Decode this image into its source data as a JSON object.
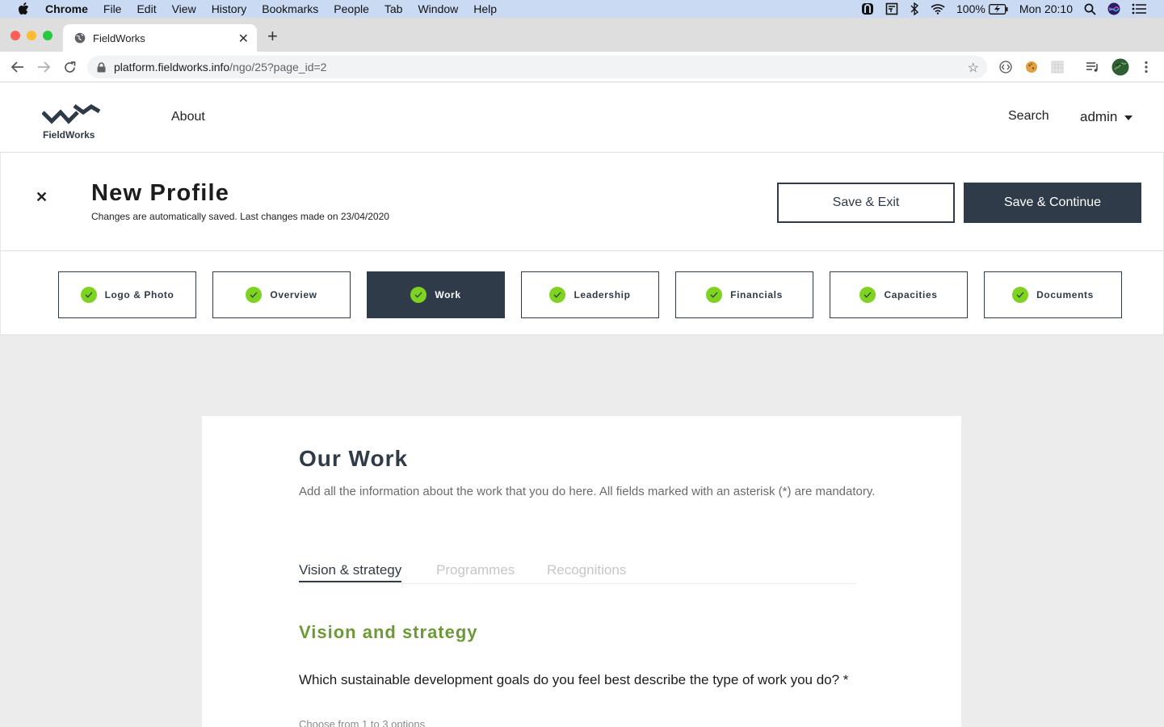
{
  "menubar": {
    "app": "Chrome",
    "items": [
      "File",
      "Edit",
      "View",
      "History",
      "Bookmarks",
      "People",
      "Tab",
      "Window",
      "Help"
    ],
    "battery": "100%",
    "clock": "Mon 20:10"
  },
  "browser": {
    "tab_title": "FieldWorks",
    "url_host": "platform.fieldworks.info",
    "url_path": "/ngo/25?page_id=2"
  },
  "site": {
    "logo_text": "FieldWorks",
    "nav_about": "About",
    "nav_search": "Search",
    "user": "admin"
  },
  "profile": {
    "title": "New Profile",
    "subtitle": "Changes are automatically saved. Last changes made on 23/04/2020",
    "save_exit": "Save & Exit",
    "save_continue": "Save & Continue"
  },
  "steps": [
    {
      "label": "Logo & Photo"
    },
    {
      "label": "Overview"
    },
    {
      "label": "Work"
    },
    {
      "label": "Leadership"
    },
    {
      "label": "Financials"
    },
    {
      "label": "Capacities"
    },
    {
      "label": "Documents"
    }
  ],
  "work": {
    "heading": "Our Work",
    "intro": "Add all the information about the work that you do here. All fields marked with an asterisk (*) are mandatory.",
    "tabs": [
      {
        "label": "Vision & strategy"
      },
      {
        "label": "Programmes"
      },
      {
        "label": "Recognitions"
      }
    ],
    "section_heading": "Vision and strategy",
    "question": "Which sustainable development goals do you feel best describe the type of work you do? *",
    "hint": "Choose from 1 to 3 options"
  },
  "colors": {
    "navy": "#2f3b48",
    "green_check": "#7ed321",
    "section_green": "#6d9a36"
  }
}
